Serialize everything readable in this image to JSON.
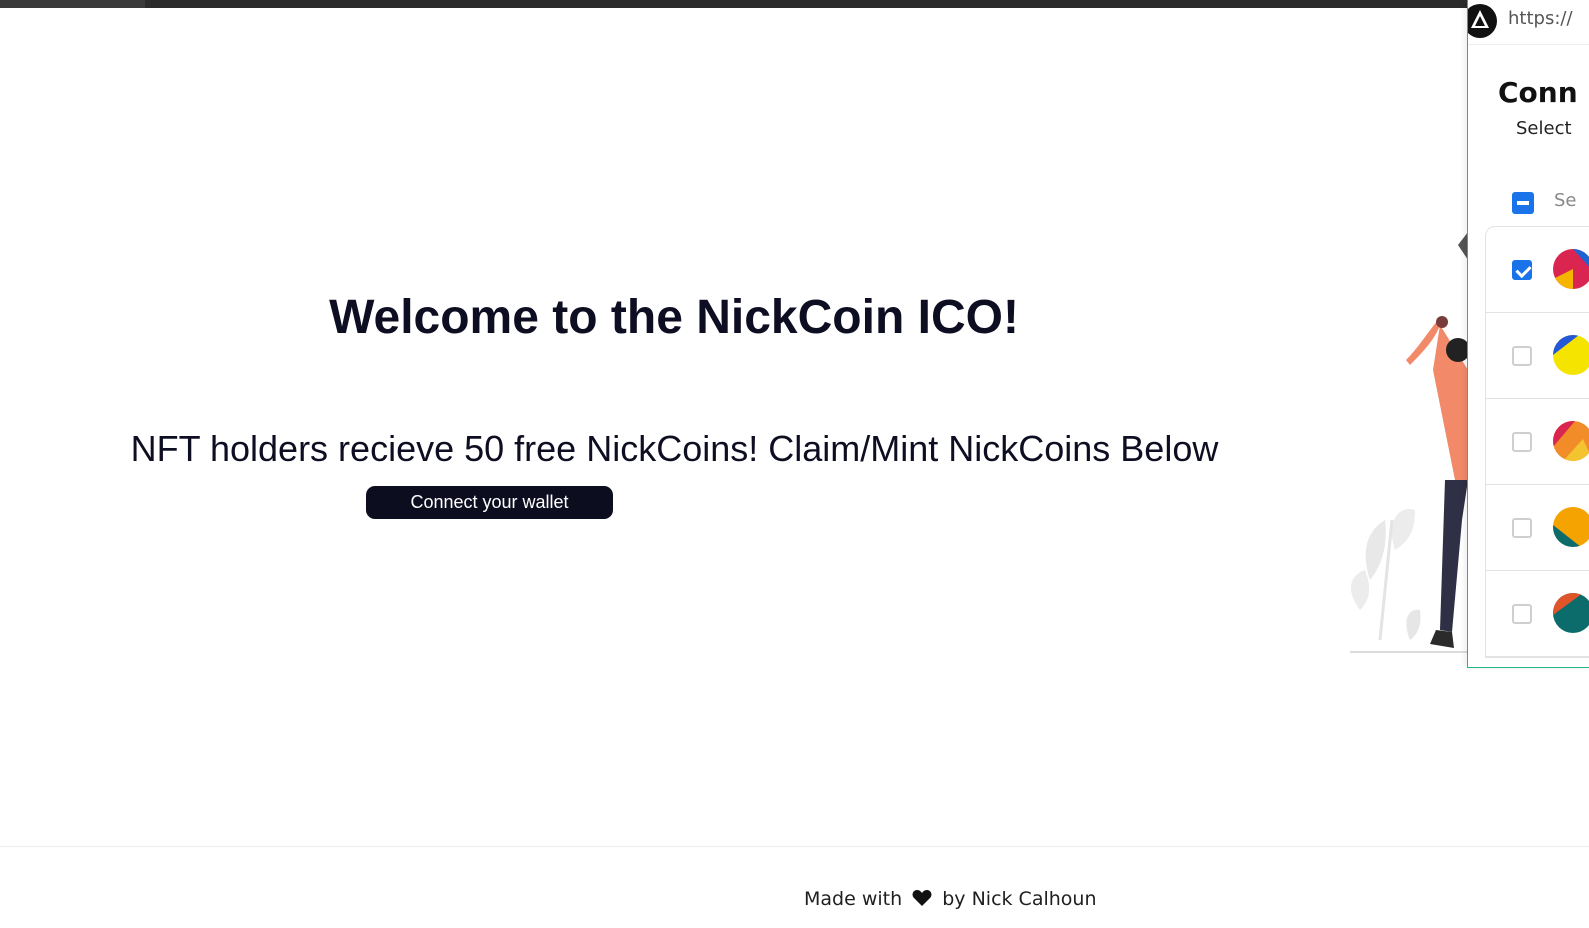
{
  "page": {
    "heading": "Welcome to the NickCoin ICO!",
    "subheading": "NFT holders recieve 50 free NickCoins! Claim/Mint NickCoins Below",
    "connect_button_label": "Connect your wallet",
    "footer": {
      "prefix": "Made with",
      "heart_icon": "heart-icon",
      "suffix": "by Nick Calhoun"
    }
  },
  "popup": {
    "url": "https://",
    "title": "Conn",
    "select_text": "Select",
    "select_all_label": "Se",
    "accounts": [
      {
        "checked": true
      },
      {
        "checked": false
      },
      {
        "checked": false
      },
      {
        "checked": false
      },
      {
        "checked": false
      }
    ]
  },
  "colors": {
    "button_bg": "#0d0d20",
    "checkbox_blue": "#1a73e8",
    "popup_border": "#21b589"
  }
}
